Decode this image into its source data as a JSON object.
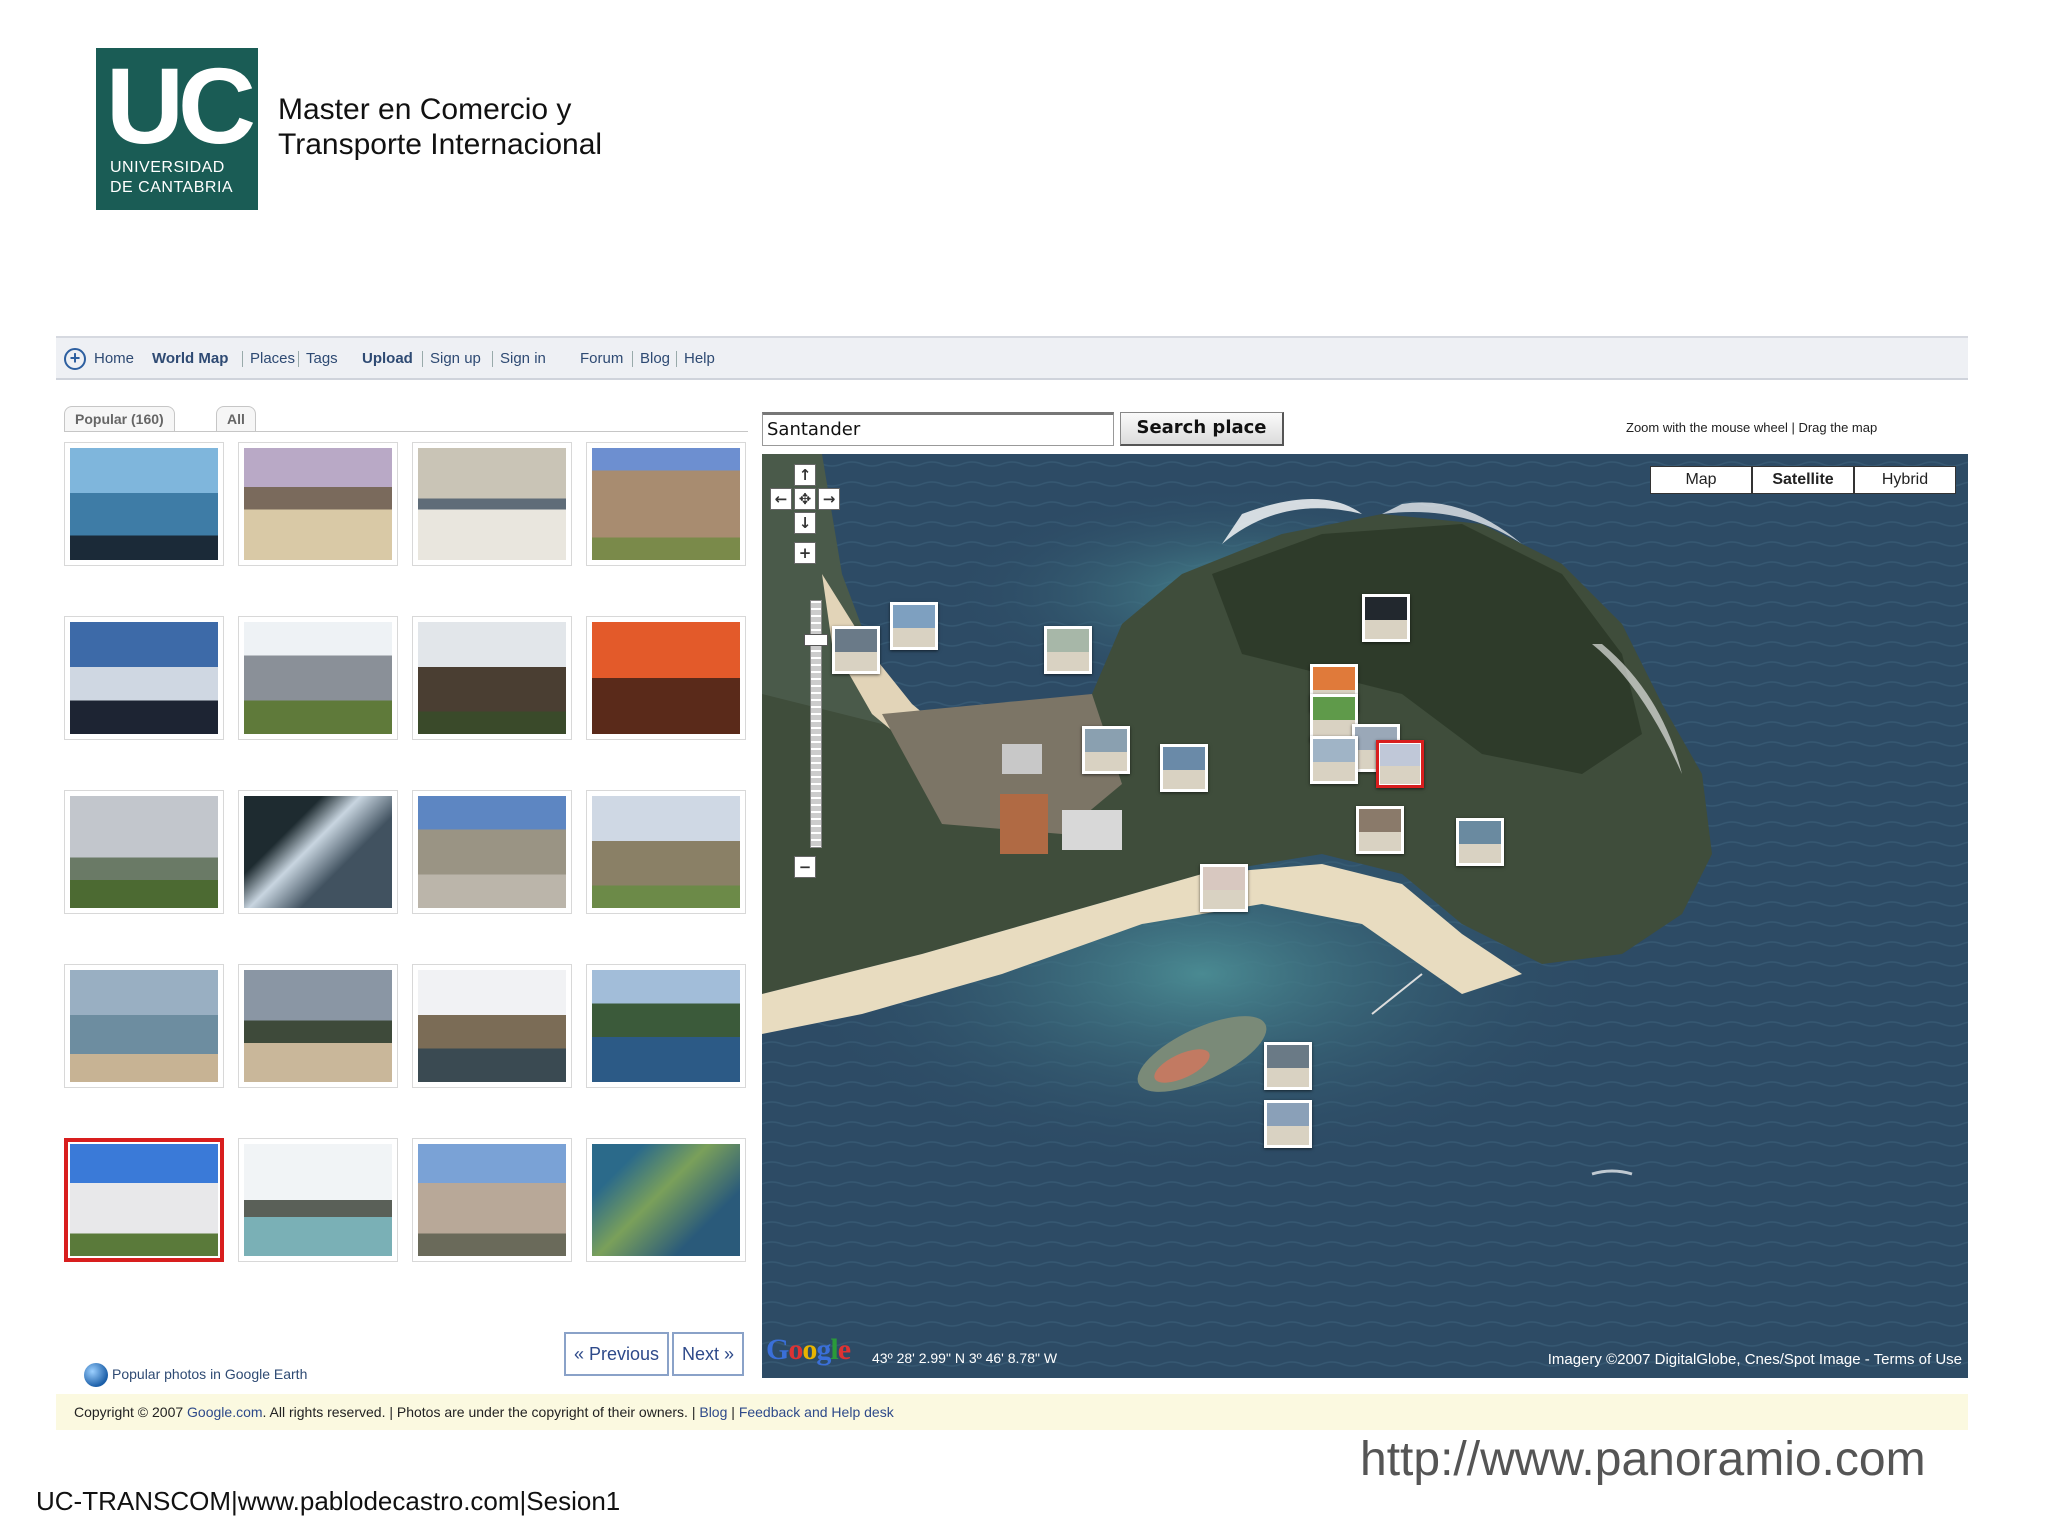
{
  "logo": {
    "initials": "UC",
    "line1": "UNIVERSIDAD",
    "line2": "DE CANTABRIA"
  },
  "course": {
    "line1": "Master  en  Comercio  y",
    "line2": "Transporte Internacional"
  },
  "nav": {
    "items": [
      "Home",
      "World Map",
      "Places",
      "Tags",
      "Upload",
      "Sign up",
      "Sign in",
      "Forum",
      "Blog",
      "Help"
    ]
  },
  "tabs": {
    "popular": "Popular (160)",
    "all": "All"
  },
  "gallery": {
    "rows": 5,
    "cols": 4,
    "selected_index": 16
  },
  "pager": {
    "previous": "« Previous",
    "next": "Next »"
  },
  "earth_link": "Popular photos in Google Earth",
  "search": {
    "value": "Santander",
    "button": "Search place"
  },
  "map_hint": "Zoom with the mouse wheel | Drag the map",
  "map_types": {
    "map": "Map",
    "satellite": "Satellite",
    "hybrid": "Hybrid",
    "active": "Satellite"
  },
  "map_controls": {
    "up": "↑",
    "left": "←",
    "center": "✥",
    "right": "→",
    "down": "↓",
    "zoom_in": "+",
    "zoom_out": "−"
  },
  "map_logo": "Google",
  "map_coords": "43º 28' 2.99\" N 3º 46' 8.78\" W",
  "map_copyright": "Imagery ©2007 DigitalGlobe, Cnes/Spot Image - Terms of Use",
  "footer": {
    "copyright": "Copyright © 2007 ",
    "site": "Google.com",
    "rights": ". All rights reserved.  |  Photos are under the copyright of their owners.  |  ",
    "blog": "Blog",
    "divider": "  |  ",
    "help": "Feedback and Help desk"
  },
  "url": "http://www.panoramio.com",
  "credit": "UC-TRANSCOM|www.pablodecastro.com|Sesion1"
}
